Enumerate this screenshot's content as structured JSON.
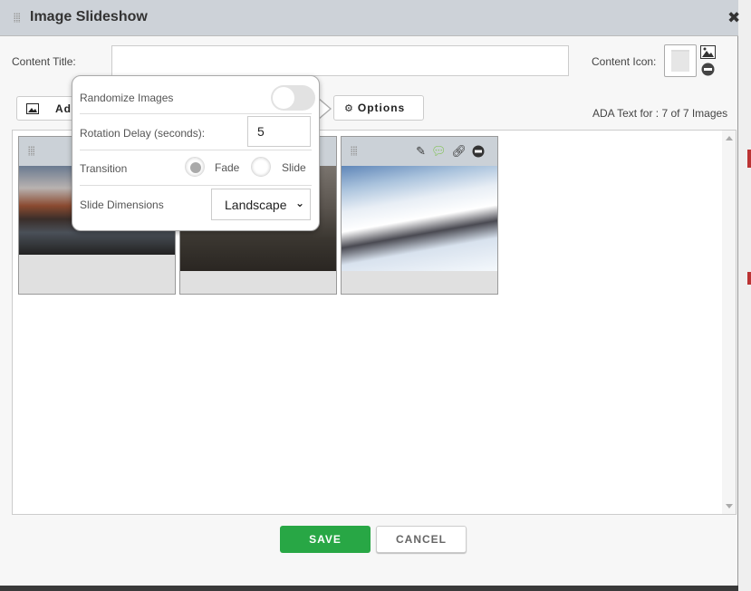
{
  "dialog": {
    "title": "Image Slideshow",
    "close_icon": "close-icon"
  },
  "form": {
    "content_title_label": "Content Title:",
    "content_title_value": "",
    "content_icon_label": "Content Icon:"
  },
  "toolbar": {
    "add_label": "Ad",
    "options_label": "Options",
    "ada_text": "ADA Text for : 7 of 7 Images"
  },
  "options_popover": {
    "randomize_label": "Randomize Images",
    "randomize_on": false,
    "delay_label": "Rotation Delay (seconds):",
    "delay_value": "5",
    "transition_label": "Transition",
    "transition_options": [
      "Fade",
      "Slide"
    ],
    "transition_selected": "Fade",
    "dimensions_label": "Slide Dimensions",
    "dimensions_value": "Landscape"
  },
  "images": [
    {
      "index": 1
    },
    {
      "index": 2
    },
    {
      "index": 3
    }
  ],
  "footer": {
    "save_label": "SAVE",
    "cancel_label": "CANCEL"
  },
  "colors": {
    "save": "#28a745",
    "header": "#cdd2d8",
    "comment_icon": "#7cc24a"
  }
}
